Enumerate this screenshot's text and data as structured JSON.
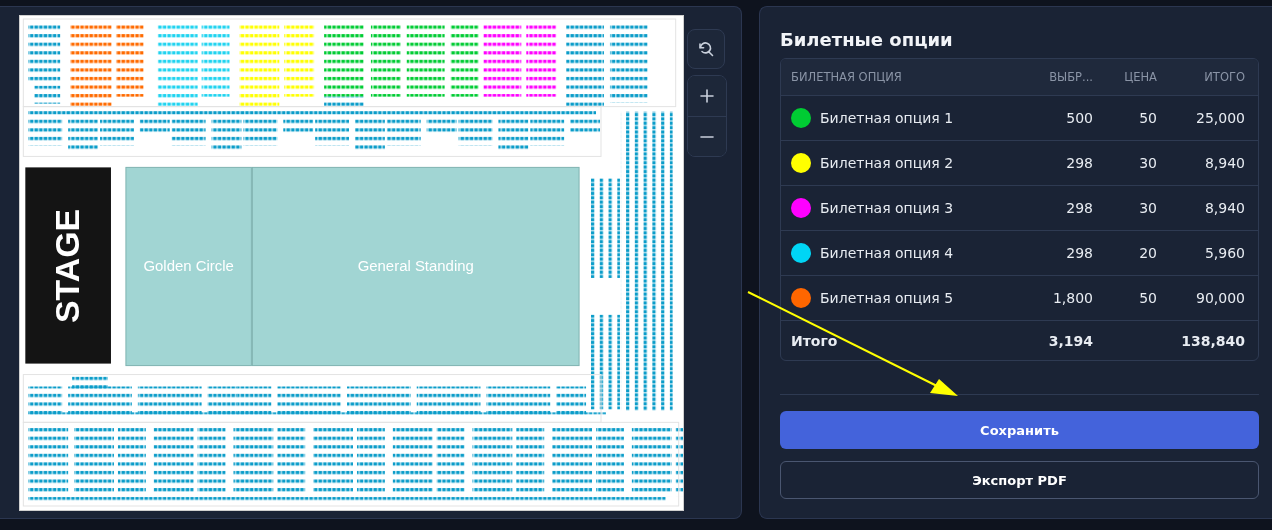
{
  "map": {
    "labels": [
      {
        "kind": "stage",
        "text": "STAGE"
      },
      {
        "kind": "zone",
        "text": "Golden Circle"
      },
      {
        "kind": "zone",
        "text": "General Standing"
      }
    ]
  },
  "panel": {
    "title": "Билетные опции",
    "table": {
      "columns": [
        "БИЛЕТНАЯ ОПЦИЯ",
        "ВЫБР...",
        "ЦЕНА",
        "ИТОГО"
      ],
      "rows": [
        {
          "name": "Билетная опция 1",
          "color": "#00cc33",
          "selected_count": "500",
          "price": "50",
          "total": "25,000"
        },
        {
          "name": "Билетная опция 2",
          "color": "#ffff00",
          "selected_count": "298",
          "price": "30",
          "total": "8,940"
        },
        {
          "name": "Билетная опция 3",
          "color": "#ff00ff",
          "selected_count": "298",
          "price": "30",
          "total": "8,940"
        },
        {
          "name": "Билетная опция 4",
          "color": "#00d5f5",
          "selected_count": "298",
          "price": "20",
          "total": "5,960"
        },
        {
          "name": "Билетная опция 5",
          "color": "#ff6600",
          "selected_count": "1,800",
          "price": "50",
          "total": "90,000"
        }
      ],
      "footer": {
        "label": "Итого",
        "selected_count": "3,194",
        "total": "138,840"
      }
    },
    "buttons": [
      {
        "kind": "primary",
        "label": "Сохранить"
      },
      {
        "kind": "secondary",
        "label": "Экспорт PDF"
      }
    ]
  }
}
